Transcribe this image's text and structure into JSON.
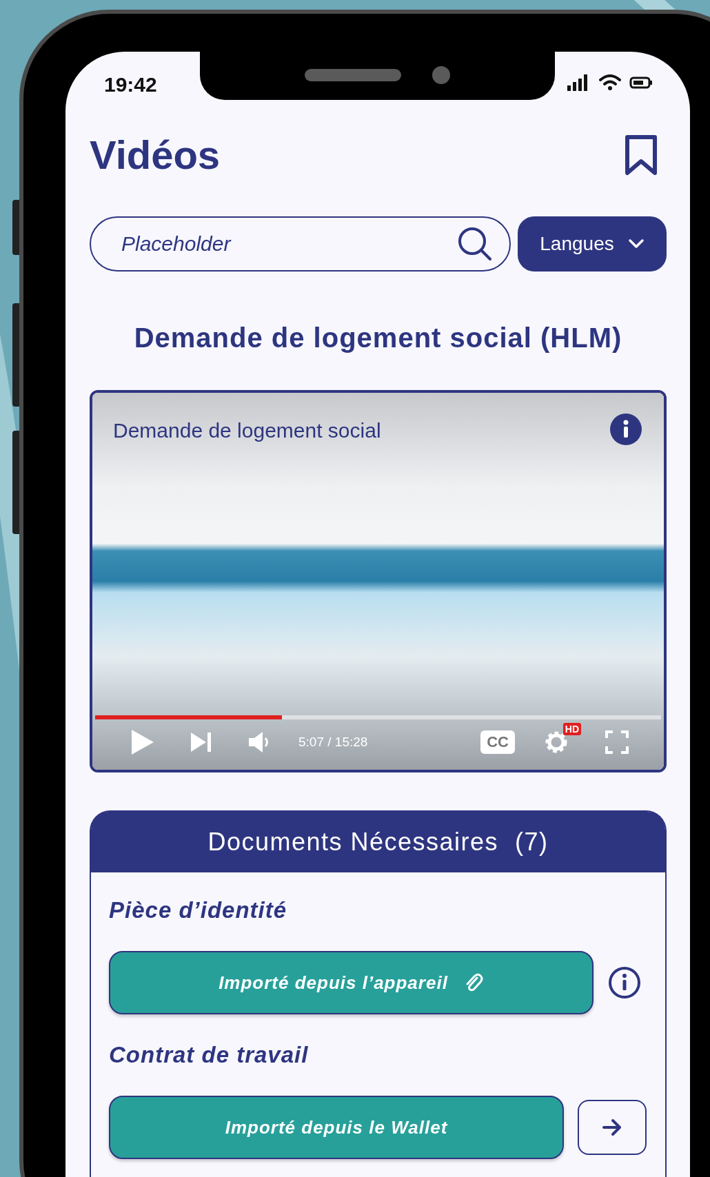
{
  "status_bar": {
    "time": "19:42"
  },
  "header": {
    "title": "Vidéos"
  },
  "search": {
    "placeholder": "Placeholder"
  },
  "language_button": {
    "label": "Langues"
  },
  "heading": "Demande de logement social (HLM)",
  "video": {
    "title": "Demande de logement social",
    "time": "5:07 / 15:28",
    "level": 0.33,
    "captions": "CC",
    "quality": "HD"
  },
  "documents": {
    "title": "Documents Nécessaires",
    "count": "(7)",
    "items": [
      {
        "label": "Pièce d’identité",
        "button": "Importé depuis l’appareil",
        "kind": "attached"
      },
      {
        "label": "Contrat de travail",
        "button": "Importé depuis le Wallet",
        "kind": "linked"
      }
    ]
  }
}
